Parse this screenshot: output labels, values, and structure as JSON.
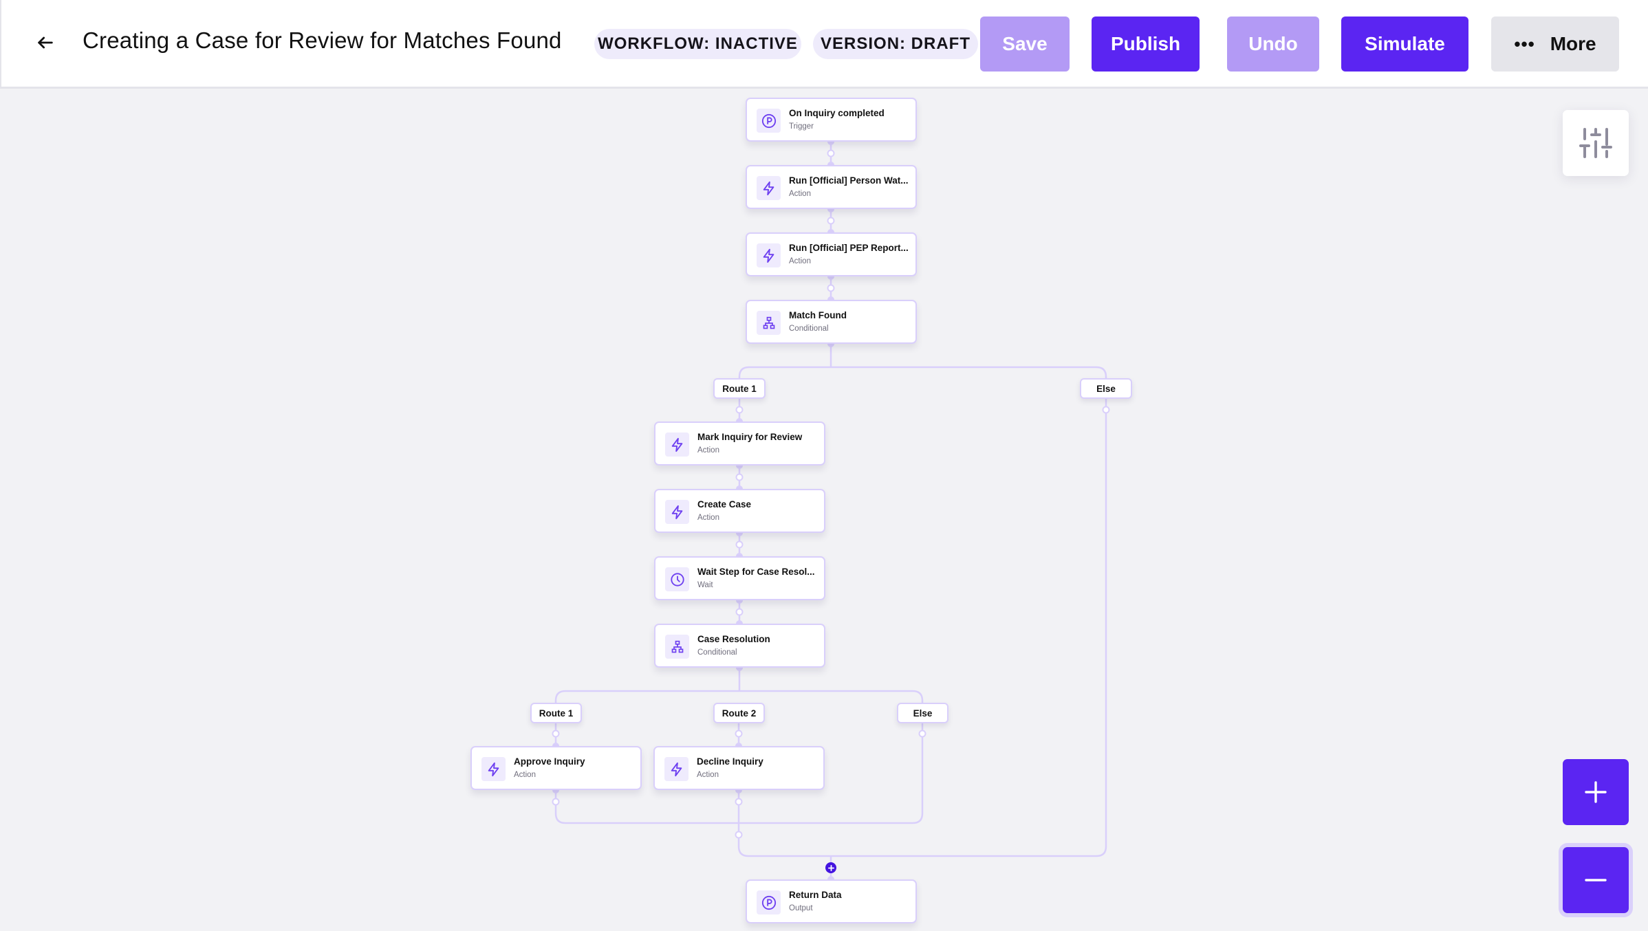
{
  "header": {
    "back_icon": "arrow-left-icon",
    "title": "Creating a Case for Review for Matches Found",
    "badges": {
      "workflow": "WORKFLOW: INACTIVE",
      "version": "VERSION: DRAFT"
    },
    "buttons": {
      "save": "Save",
      "publish": "Publish",
      "undo": "Undo",
      "simulate": "Simulate",
      "more": "More",
      "more_icon": "ellipsis-icon"
    }
  },
  "colors": {
    "primary": "#5b25f2",
    "primary_disabled": "#b39af5",
    "badge_bg": "#eeebfb",
    "connector": "#d9cffb",
    "canvas_bg": "#f2f2f5"
  },
  "workflow": {
    "nodes": [
      {
        "id": "trigger",
        "title": "On Inquiry completed",
        "type": "Trigger",
        "icon": "persona-p-icon"
      },
      {
        "id": "watchlist",
        "title": "Run [Official] Person Wat...",
        "type": "Action",
        "icon": "lightning-icon"
      },
      {
        "id": "pep",
        "title": "Run [Official] PEP Report...",
        "type": "Action",
        "icon": "lightning-icon"
      },
      {
        "id": "match",
        "title": "Match Found",
        "type": "Conditional",
        "icon": "hierarchy-icon"
      },
      {
        "id": "mark",
        "title": "Mark Inquiry for Review",
        "type": "Action",
        "icon": "lightning-icon"
      },
      {
        "id": "create",
        "title": "Create Case",
        "type": "Action",
        "icon": "lightning-icon"
      },
      {
        "id": "wait",
        "title": "Wait Step for Case Resol...",
        "type": "Wait",
        "icon": "clock-icon"
      },
      {
        "id": "resolution",
        "title": "Case Resolution",
        "type": "Conditional",
        "icon": "hierarchy-icon"
      },
      {
        "id": "approve",
        "title": "Approve Inquiry",
        "type": "Action",
        "icon": "lightning-icon"
      },
      {
        "id": "decline",
        "title": "Decline Inquiry",
        "type": "Action",
        "icon": "lightning-icon"
      },
      {
        "id": "return",
        "title": "Return Data",
        "type": "Output",
        "icon": "persona-p-icon"
      }
    ],
    "routes": {
      "match_route1": "Route 1",
      "match_else": "Else",
      "res_route1": "Route 1",
      "res_route2": "Route 2",
      "res_else": "Else"
    }
  },
  "canvas_controls": {
    "settings_icon": "sliders-icon",
    "zoom_in_icon": "plus-icon",
    "zoom_out_icon": "minus-icon"
  }
}
